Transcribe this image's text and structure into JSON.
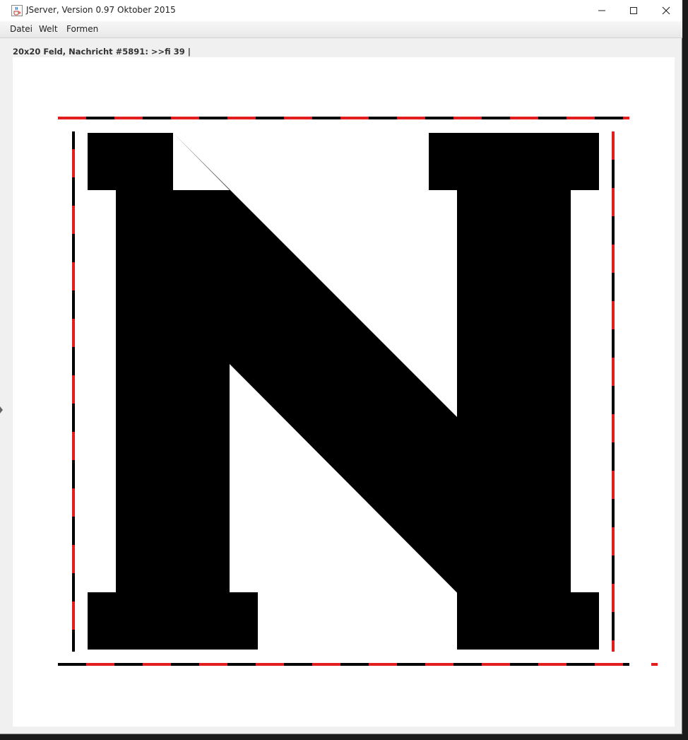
{
  "window": {
    "title": "JServer, Version 0.97 Oktober 2015",
    "icon": "java-cup-icon",
    "controls": [
      "minimize-icon",
      "maximize-icon",
      "close-icon"
    ]
  },
  "menu": {
    "items": [
      "Datei",
      "Welt",
      "Formen"
    ]
  },
  "status": {
    "text": "20x20 Feld, Nachricht #5891: >>fi 39 |"
  },
  "board": {
    "size": "20x20",
    "figure": "N",
    "colors": {
      "background": "#ffffff",
      "figure": "#000000",
      "dash_red": "#e31d1d",
      "dash_black": "#000000"
    }
  }
}
